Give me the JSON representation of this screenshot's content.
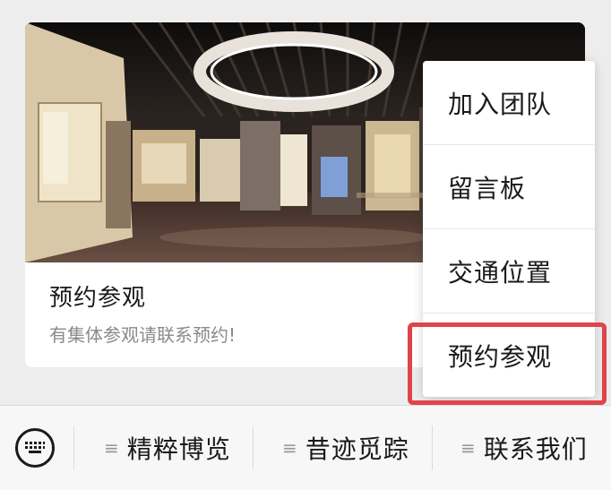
{
  "card": {
    "title": "预约参观",
    "description": "有集体参观请联系预约!"
  },
  "menu": {
    "items": [
      {
        "label": "加入团队"
      },
      {
        "label": "留言板"
      },
      {
        "label": "交通位置"
      },
      {
        "label": "预约参观"
      }
    ],
    "highlighted_index": 3,
    "highlight_color": "#e0444b"
  },
  "bottom_bar": {
    "keyboard_icon": "keyboard-icon",
    "items": [
      {
        "icon": "menu-lines-icon",
        "label": "精粹博览"
      },
      {
        "icon": "menu-lines-icon",
        "label": "昔迹觅踪"
      },
      {
        "icon": "menu-lines-icon",
        "label": "联系我们"
      }
    ]
  }
}
